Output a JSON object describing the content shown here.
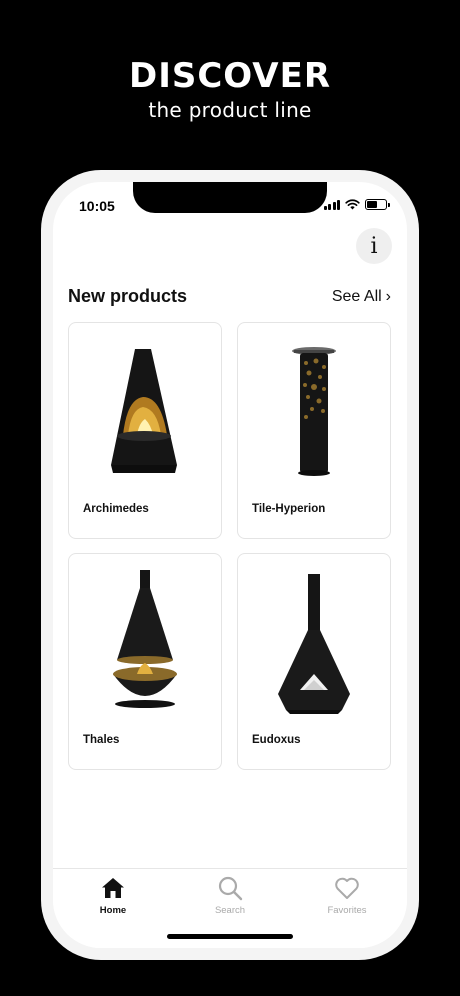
{
  "promo": {
    "title": "DISCOVER",
    "subtitle": "the product line"
  },
  "status_bar": {
    "time": "10:05",
    "icons": [
      "signal-icon",
      "wifi-icon",
      "battery-icon"
    ]
  },
  "header": {
    "info_icon": "i"
  },
  "section": {
    "title": "New products",
    "see_all_label": "See All",
    "see_all_icon": "›"
  },
  "products": [
    {
      "name": "Archimedes",
      "image": "cone-fireplace-with-open-front"
    },
    {
      "name": "Tile-Hyperion",
      "image": "column-heater-with-perforated-top"
    },
    {
      "name": "Thales",
      "image": "suspended-cone-hood-over-fire-bowl"
    },
    {
      "name": "Eudoxus",
      "image": "angular-chimney-fireplace"
    }
  ],
  "tabs": [
    {
      "label": "Home",
      "icon": "home-icon",
      "active": true
    },
    {
      "label": "Search",
      "icon": "search-icon",
      "active": false
    },
    {
      "label": "Favorites",
      "icon": "heart-icon",
      "active": false
    }
  ],
  "colors": {
    "background": "#000000",
    "screen": "#ffffff",
    "accent_flame": "#c8922a",
    "text": "#111111",
    "inactive_tab": "#aaaaaa"
  }
}
